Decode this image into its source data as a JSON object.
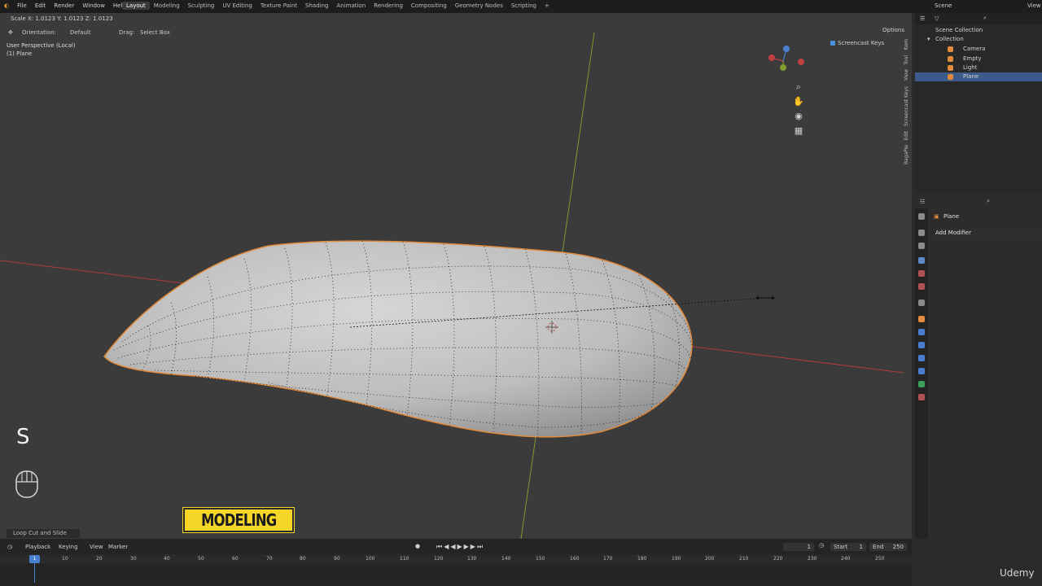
{
  "menu": [
    "File",
    "Edit",
    "Render",
    "Window",
    "Help"
  ],
  "workspaces": [
    "Layout",
    "Modeling",
    "Sculpting",
    "UV Editing",
    "Texture Paint",
    "Shading",
    "Animation",
    "Rendering",
    "Compositing",
    "Geometry Nodes",
    "Scripting",
    "+"
  ],
  "active_workspace": "Layout",
  "scene": "Scene",
  "view_layer": "View",
  "header": {
    "status": "Scale X: 1.0123   Y: 1.0123   Z: 1.0123"
  },
  "tool_header": {
    "orientation_label": "Orientation:",
    "orientation_value": "Default",
    "drag_label": "Drag:",
    "drag_value": "Select Box",
    "options": "Options"
  },
  "viewport": {
    "view_name": "User Perspective (Local)",
    "object_name": "(1) Plane",
    "screencast_keys": "Screencast Keys",
    "key_pressed": "S",
    "badge": "MODELING",
    "last_operator": "Loop Cut and Slide",
    "n_tabs": [
      "Item",
      "Tool",
      "View",
      "Screencast Keys",
      "Edit",
      "BagaPie"
    ]
  },
  "outliner": {
    "root": "Scene Collection",
    "collection": "Collection",
    "items": [
      {
        "name": "Camera",
        "color": "#e08a3c"
      },
      {
        "name": "Empty",
        "color": "#e08a3c"
      },
      {
        "name": "Light",
        "color": "#e08a3c"
      },
      {
        "name": "Plane",
        "color": "#e08a3c",
        "selected": true
      }
    ]
  },
  "properties": {
    "object": "Plane",
    "add_modifier": "Add Modifier"
  },
  "timeline": {
    "menus": [
      "Playback",
      "Keying",
      "View",
      "Marker"
    ],
    "current_frame": "1",
    "frame_field": "1",
    "start_label": "Start",
    "start": "1",
    "end_label": "End",
    "end": "250",
    "ticks": [
      "10",
      "20",
      "30",
      "40",
      "50",
      "60",
      "70",
      "80",
      "90",
      "100",
      "110",
      "120",
      "130",
      "140",
      "150",
      "160",
      "170",
      "180",
      "190",
      "200",
      "210",
      "220",
      "230",
      "240",
      "250"
    ]
  },
  "watermark": "Udemy",
  "colors": {
    "x_axis": "#c0392b",
    "y_axis": "#8aa83a",
    "selection": "#e08a3c",
    "badge": "#f6d728",
    "accent": "#4a7fd0"
  }
}
